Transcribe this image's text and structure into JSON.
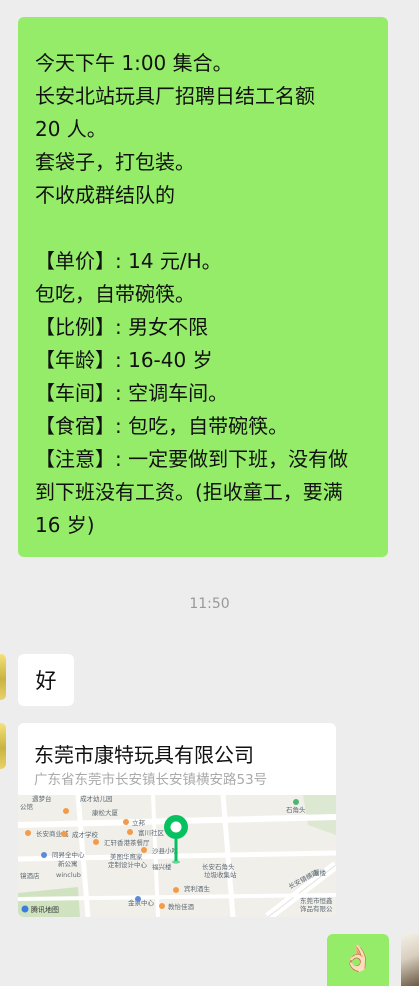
{
  "message_main": {
    "lines": [
      "今天下午 1:00 集合。",
      "长安北站玩具厂招聘日结工名额",
      "20 人。",
      "套袋子，打包装。",
      "不收成群结队的",
      "",
      "【单价】: 14 元/H。",
      "包吃，自带碗筷。",
      "【比例】: 男女不限",
      "【年龄】: 16-40 岁",
      "【车间】: 空调车间。",
      "【食宿】: 包吃，自带碗筷。",
      "【注意】: 一定要做到下班，没有做",
      "到下班没有工资。(拒收童工，要满",
      "16 岁)"
    ]
  },
  "timestamp": "11:50",
  "reply": {
    "text": "好"
  },
  "location": {
    "title": "东莞市康特玩具有限公司",
    "address": "广东省东莞市长安镇长安镇横安路53号",
    "map_labels": {
      "l1": "遇梦台",
      "l2": "成才幼儿园",
      "l3": "石角头",
      "l4": "公馆",
      "l5": "康松大厦",
      "l6": "长安商业城",
      "l7": "立邦",
      "l8": "成才学校",
      "l9": "富川社区",
      "l10": "汇轩香港茶餐厅",
      "l11": "沙县小吃",
      "l12": "同昇全中心",
      "l13": "新公寓",
      "l14": "美图华鹰家",
      "l15": "定制设计中心",
      "l16": "福兴楼",
      "l17": "长安石角头",
      "l18": "垃圾收集站",
      "l19": "潘楼",
      "l20": "镜酒店",
      "l21": "winclub",
      "l22": "长安镇横路",
      "l23": "东莞市恒鑫",
      "l24": "饰品有限公",
      "l25": "宾利酒生",
      "l26": "金泉中心",
      "l27": "教怡佳酒",
      "watermark": "腾讯地图"
    }
  },
  "reaction_emoji": "👌🏻",
  "colors": {
    "background": "#ededed",
    "self_bubble": "#95ec69",
    "other_bubble": "#ffffff",
    "map_pin": "#07c160"
  }
}
